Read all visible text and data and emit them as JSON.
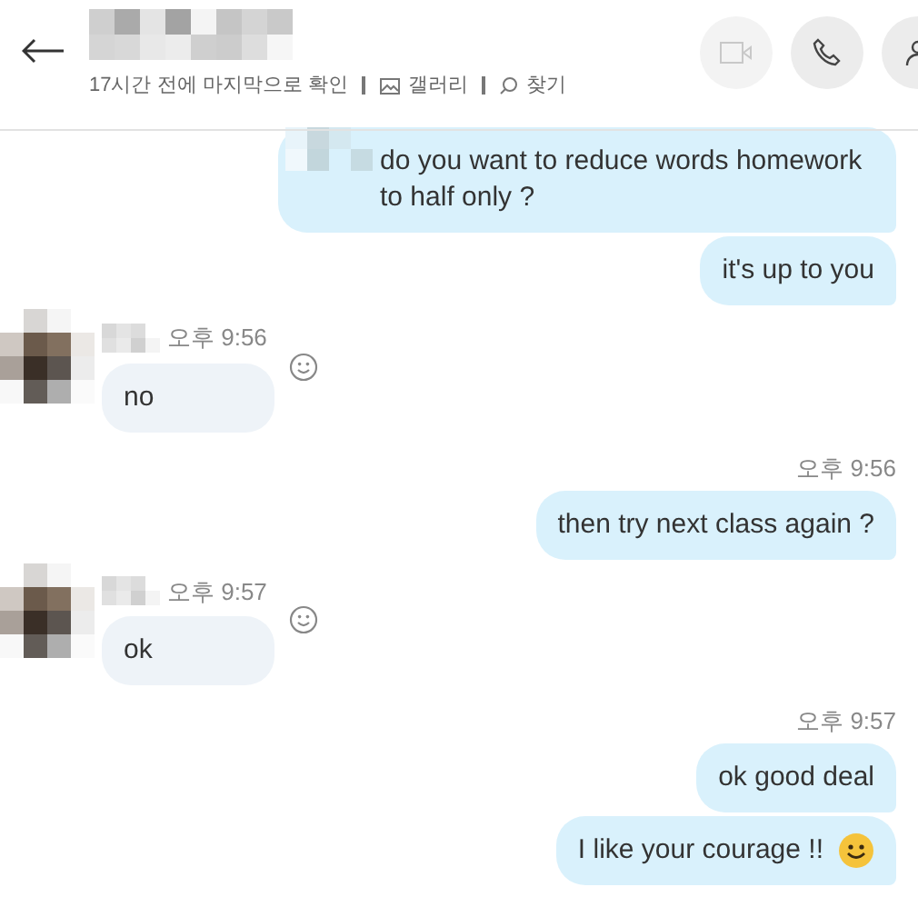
{
  "header": {
    "subtitle": "17시간 전에 마지막으로 확인",
    "gallery_link": "갤러리",
    "search_link": "찾기"
  },
  "messages": [
    {
      "kind": "sent",
      "hidden_prefix": true,
      "text": "do you want to reduce words homework to half only ?"
    },
    {
      "kind": "sent",
      "text": "it's up to you"
    },
    {
      "kind": "received",
      "time": "오후 9:56",
      "text": "no"
    },
    {
      "kind": "sent",
      "time": "오후 9:56",
      "text": "then try next class again ?"
    },
    {
      "kind": "received",
      "time": "오후 9:57",
      "text": "ok"
    },
    {
      "kind": "sent",
      "time": "오후 9:57",
      "text": "ok good deal"
    },
    {
      "kind": "sent",
      "text": "I like your courage !!",
      "emoji": true
    }
  ]
}
